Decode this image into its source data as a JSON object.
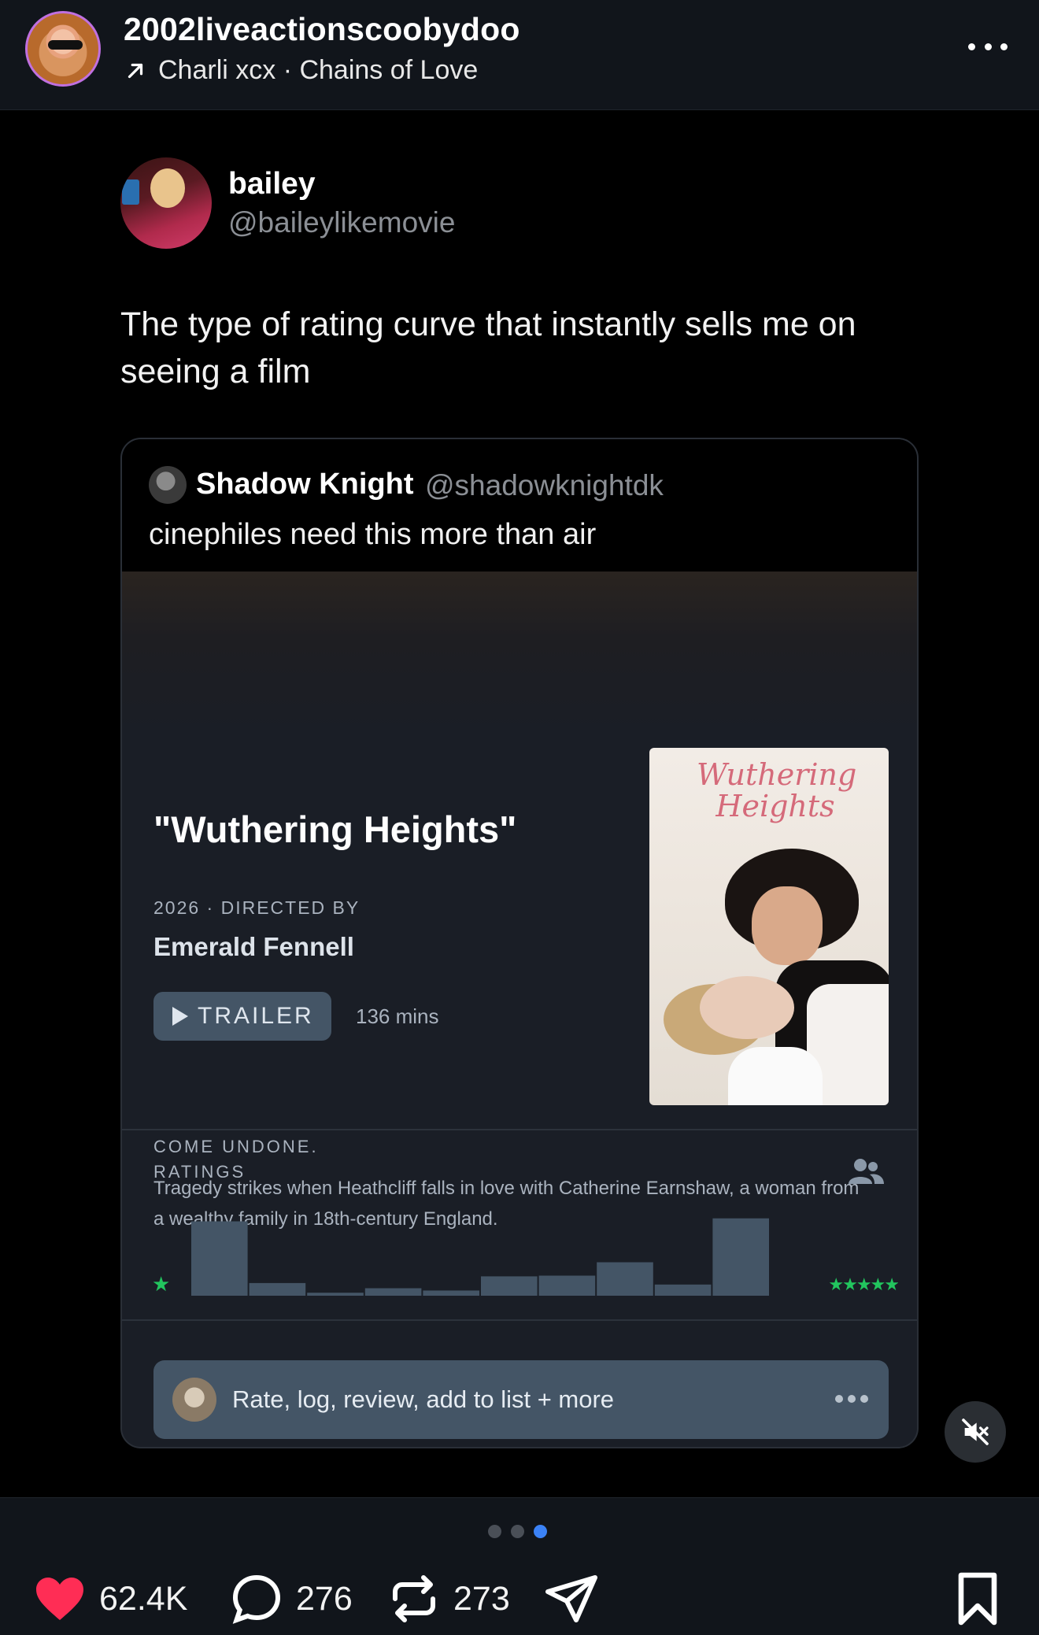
{
  "header": {
    "username": "2002liveactionscoobydoo",
    "music": "Charli xcx · Chains of Love"
  },
  "tweet": {
    "name": "bailey",
    "handle": "@baileylikemovie",
    "text": "The type of rating curve that instantly sells me on seeing a film"
  },
  "quote": {
    "name": "Shadow Knight",
    "handle": "@shadowknightdk",
    "text": "cinephiles need this more than air"
  },
  "film": {
    "title": "\"Wuthering Heights\"",
    "meta": "2026 · DIRECTED BY",
    "director": "Emerald Fennell",
    "trailer_label": "TRAILER",
    "runtime": "136 mins",
    "poster_title": "Wuthering Heights",
    "tagline": "COME UNDONE.",
    "synopsis": "Tragedy strikes when Heathcliff falls in love with Catherine Earnshaw, a woman from a wealthy family in 18th-century England."
  },
  "ratings": {
    "label": "RATINGS",
    "low_label": "★",
    "high_label": "★★★★★"
  },
  "chart_data": {
    "type": "bar",
    "categories": [
      "0.5",
      "1",
      "1.5",
      "2",
      "2.5",
      "3",
      "3.5",
      "4",
      "4.5",
      "5"
    ],
    "values": [
      100,
      17,
      4,
      10,
      7,
      26,
      27,
      45,
      15,
      104
    ],
    "ylim": [
      0,
      110
    ],
    "colors": {
      "bar": "#445566",
      "star": "#22c55e"
    },
    "grid": false
  },
  "rate_bar": {
    "text": "Rate, log, review, add to list + more"
  },
  "actions": {
    "likes": "62.4K",
    "comments": "276",
    "reposts": "273"
  },
  "pager": {
    "count": 3,
    "active": 2
  },
  "colors": {
    "like": "#ff2d55",
    "pager_active": "#3b82f6"
  },
  "icons": [
    "arrow-up-right-icon",
    "more-icon",
    "friends-icon",
    "mute-icon",
    "heart-icon",
    "comment-icon",
    "repost-icon",
    "share-icon",
    "bookmark-icon"
  ]
}
